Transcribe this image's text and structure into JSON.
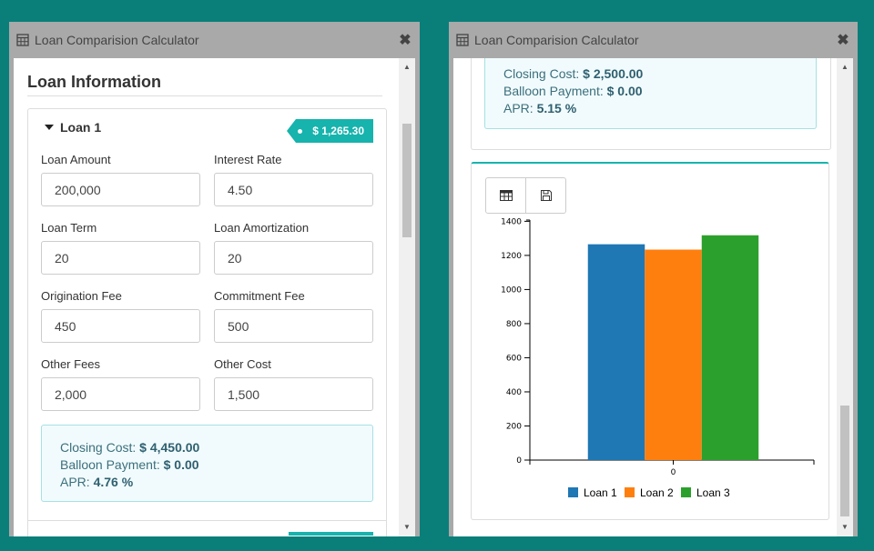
{
  "left_window": {
    "title": "Loan Comparision Calculator",
    "close_label": "✖",
    "section_title": "Loan Information",
    "loan_name": "Loan 1",
    "monthly_payment": "$ 1,265.30",
    "fields": {
      "loan_amount": {
        "label": "Loan Amount",
        "value": "200,000"
      },
      "interest_rate": {
        "label": "Interest Rate",
        "value": "4.50"
      },
      "loan_term": {
        "label": "Loan Term",
        "value": "20"
      },
      "loan_amortization": {
        "label": "Loan Amortization",
        "value": "20"
      },
      "origination_fee": {
        "label": "Origination Fee",
        "value": "450"
      },
      "commitment_fee": {
        "label": "Commitment Fee",
        "value": "500"
      },
      "other_fees": {
        "label": "Other Fees",
        "value": "2,000"
      },
      "other_cost": {
        "label": "Other Cost",
        "value": "1,500"
      }
    },
    "summary": {
      "closing_cost_label": "Closing Cost:",
      "closing_cost_value": "$ 4,450.00",
      "balloon_label": "Balloon Payment:",
      "balloon_value": "$ 0.00",
      "apr_label": "APR:",
      "apr_value": "4.76 %"
    }
  },
  "right_window": {
    "title": "Loan Comparision Calculator",
    "close_label": "✖",
    "summary": {
      "closing_cost_label": "Closing Cost:",
      "closing_cost_value": "$ 2,500.00",
      "balloon_label": "Balloon Payment:",
      "balloon_value": "$ 0.00",
      "apr_label": "APR:",
      "apr_value": "5.15 %"
    },
    "toolbar": {
      "table_icon": "table-icon",
      "save_icon": "save-icon"
    }
  },
  "colors": {
    "background": "#0a7f7a",
    "accent": "#17b3ad",
    "loan1": "#1f77b4",
    "loan2": "#ff7f0e",
    "loan3": "#2ca02c"
  },
  "chart_data": {
    "type": "bar",
    "categories": [
      "0"
    ],
    "series": [
      {
        "name": "Loan 1",
        "values": [
          1265.3
        ]
      },
      {
        "name": "Loan 2",
        "values": [
          1234
        ]
      },
      {
        "name": "Loan 3",
        "values": [
          1318
        ]
      }
    ],
    "ylim": [
      0,
      1450
    ],
    "yticks": [
      "0",
      "200",
      "400",
      "600",
      "800",
      "1000",
      "1200",
      "1400"
    ],
    "legend": "bottom"
  }
}
